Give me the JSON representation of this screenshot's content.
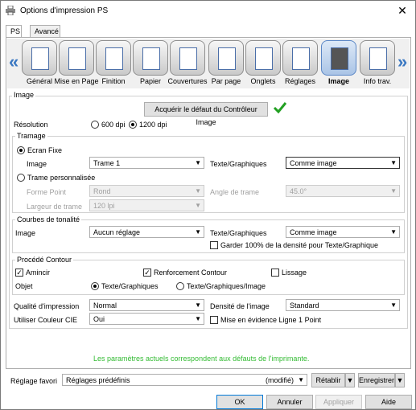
{
  "window": {
    "title": "Options d'impression PS",
    "close": "✕"
  },
  "tabs": [
    "PS",
    "Avancé"
  ],
  "categories": [
    {
      "label": "Général"
    },
    {
      "label": "Mise en Page"
    },
    {
      "label": "Finition"
    },
    {
      "label": "Papier"
    },
    {
      "label": "Couvertures"
    },
    {
      "label": "Par page"
    },
    {
      "label": "Onglets"
    },
    {
      "label": "Réglages"
    },
    {
      "label": "Image"
    },
    {
      "label": "Info trav."
    }
  ],
  "nav": {
    "prev": "«",
    "next": "»"
  },
  "image_section": {
    "heading": "Image",
    "acquire_button": "Acquérir le défaut du Contrôleur Image",
    "resolution_label": "Résolution",
    "res_600": "600 dpi",
    "res_1200": "1200 dpi"
  },
  "tramage": {
    "heading": "Tramage",
    "ecran_fixe": "Ecran Fixe",
    "image_label": "Image",
    "image_value": "Trame 1",
    "texte_label": "Texte/Graphiques",
    "texte_value": "Comme image",
    "trame_perso": "Trame personnalisée",
    "forme_point_label": "Forme Point",
    "forme_point_value": "Rond",
    "angle_label": "Angle de trame",
    "angle_value": "45.0°",
    "largeur_label": "Largeur de trame",
    "largeur_value": "120 lpi"
  },
  "courbes": {
    "heading": "Courbes de tonalité",
    "image_label": "Image",
    "image_value": "Aucun réglage",
    "texte_label": "Texte/Graphiques",
    "texte_value": "Comme image",
    "garder": "Garder 100% de la densité pour Texte/Graphique"
  },
  "contour": {
    "heading": "Procédé Contour",
    "amincir": "Amincir",
    "renforcement": "Renforcement Contour",
    "lissage": "Lissage",
    "objet_label": "Objet",
    "opt_texte": "Texte/Graphiques",
    "opt_texte_image": "Texte/Graphiques/Image"
  },
  "bottom": {
    "qualite_label": "Qualité d'impression",
    "qualite_value": "Normal",
    "densite_label": "Densité de l'image",
    "densite_value": "Standard",
    "couleur_label": "Utiliser Couleur CIE",
    "couleur_value": "Oui",
    "mise_evidence": "Mise en évidence Ligne 1 Point"
  },
  "info_message": "Les paramètres actuels correspondent aux défauts de l'imprimante.",
  "favori": {
    "label": "Réglage favori",
    "value": "Réglages prédéfinis",
    "modified": "(modifié)",
    "restore": "Rétablir",
    "save": "Enregistrer"
  },
  "dialog_buttons": {
    "ok": "OK",
    "cancel": "Annuler",
    "apply": "Appliquer",
    "help": "Aide"
  },
  "colors": {
    "accent": "#3a78c2",
    "info_green": "#33bb33",
    "check_green": "#22a022"
  }
}
